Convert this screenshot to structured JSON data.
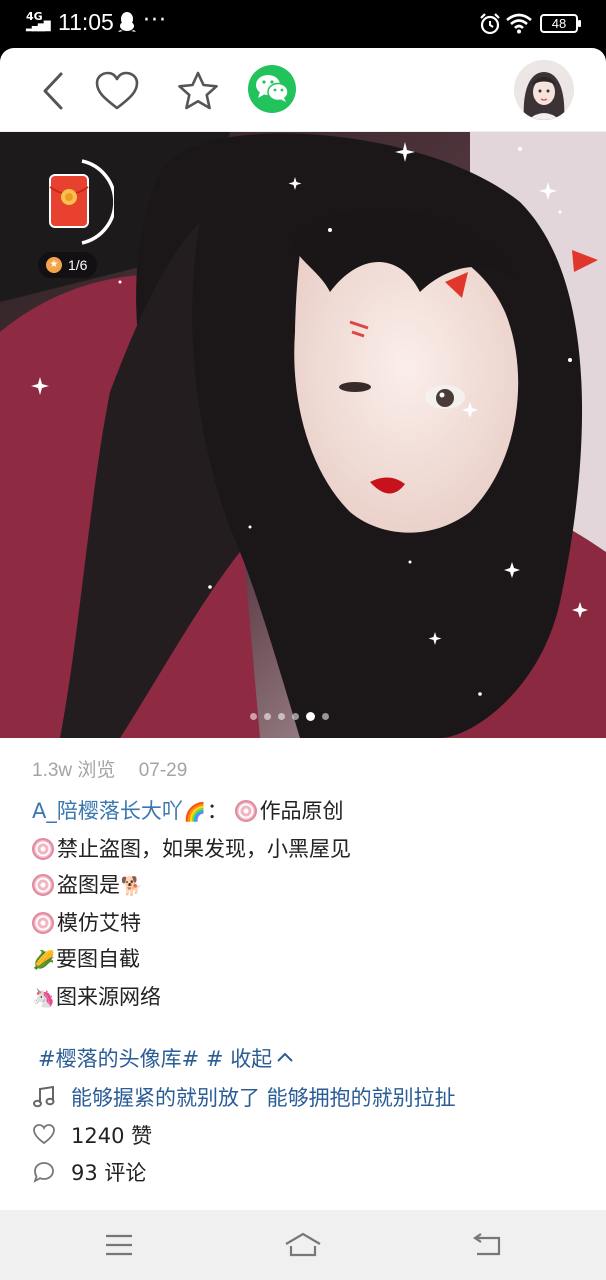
{
  "status_bar": {
    "network": "4G",
    "time": "11:05",
    "more": "···",
    "battery": "48"
  },
  "post": {
    "views": "1.3w 浏览",
    "date": "07-29",
    "author": "A_陪樱落长大吖",
    "colon": "：",
    "lines": [
      "作品原创",
      "禁止盗图，如果发现，小黑屋见",
      "盗图是",
      "模仿艾特",
      "要图自截",
      "图来源网络"
    ],
    "emoji": {
      "rainbow": "🌈",
      "dog": "🐕",
      "corn": "🌽",
      "unicorn": "🦄"
    },
    "tag": "#樱落的头像库#",
    "hash": "#",
    "collapse": "收起",
    "collapse_icon": "^",
    "music": "能够握紧的就别放了 能够拥抱的就别拉扯",
    "likes": "1240 赞",
    "comments": "93 评论"
  },
  "gallery": {
    "page_indicator": "1/6",
    "dot_count": 6,
    "active_dot": 5
  }
}
